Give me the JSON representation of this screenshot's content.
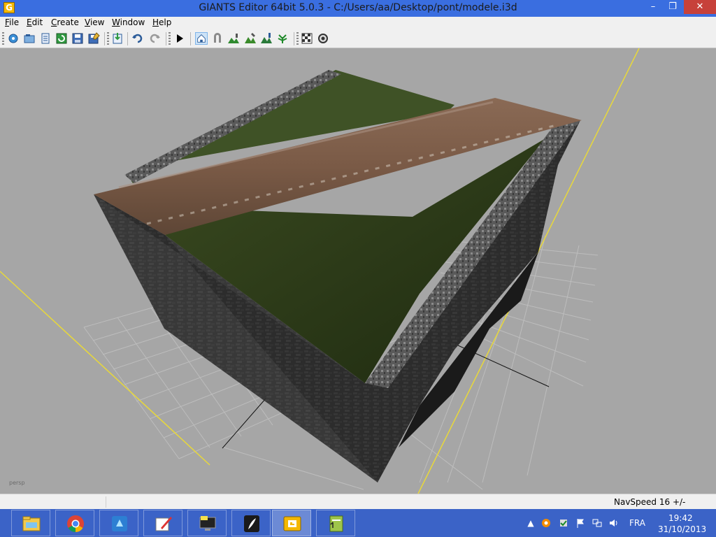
{
  "window": {
    "title": "GIANTS Editor 64bit 5.0.3 - C:/Users/aa/Desktop/pont/modele.i3d",
    "app_icon": "giants-logo-icon",
    "minimize": "–",
    "maximize": "❐",
    "close": "✕"
  },
  "menu": {
    "items": [
      {
        "label": "File",
        "mnemonic": "F"
      },
      {
        "label": "Edit",
        "mnemonic": "E"
      },
      {
        "label": "Create",
        "mnemonic": "C"
      },
      {
        "label": "View",
        "mnemonic": "V"
      },
      {
        "label": "Window",
        "mnemonic": "W"
      },
      {
        "label": "Help",
        "mnemonic": "H"
      }
    ]
  },
  "toolbar": {
    "buttons": [
      "new-icon",
      "open-icon",
      "open-list-icon",
      "refresh-icon",
      "save-icon",
      "save-as-icon",
      "import-icon",
      "undo-icon",
      "redo-icon",
      "play-icon",
      "select-mode-icon",
      "move-mode-icon",
      "terrain-paint-icon",
      "terrain-sculpt-icon",
      "foliage-icon",
      "plant-icon",
      "render-settings-icon",
      "network-icon"
    ]
  },
  "viewport": {
    "camera": "persp"
  },
  "status": {
    "navspeed": "NavSpeed 16 +/-"
  },
  "taskbar": {
    "apps": [
      "file-explorer-icon",
      "chrome-icon",
      "app-blue-icon",
      "paint-icon",
      "monitor-icon",
      "quill-icon",
      "giants-editor-icon",
      "notepad-icon"
    ],
    "tray": [
      "avast-icon",
      "check-icon",
      "flag-icon",
      "network-icon",
      "volume-icon"
    ],
    "language": "FRA",
    "time": "19:42",
    "date": "31/10/2013"
  },
  "colors": {
    "titlebar": "#3a6ee0",
    "taskbar": "#3b63c7",
    "viewport_bg": "#a6a6a6",
    "close_button": "#c7413a"
  }
}
